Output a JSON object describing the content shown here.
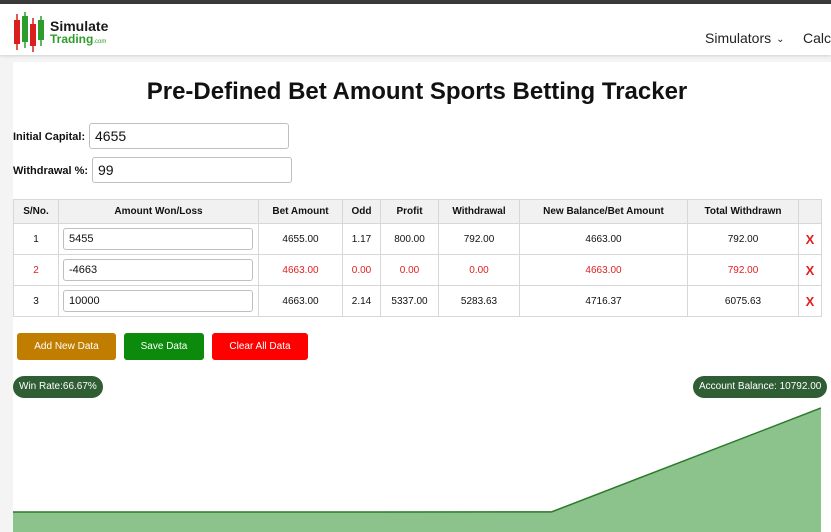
{
  "brand": {
    "name_line1": "Simulate",
    "name_line2": "Trading",
    "domain_suffix": ".com",
    "accent_color": "#2e9d2e"
  },
  "nav": {
    "simulators": "Simulators",
    "calculators": "Calculators"
  },
  "title": "Pre-Defined Bet Amount Sports Betting Tracker",
  "form": {
    "initial_capital_label": "Initial Capital:",
    "initial_capital_value": "4655",
    "withdrawal_label": "Withdrawal %:",
    "withdrawal_value": "99"
  },
  "table": {
    "headers": [
      "S/No.",
      "Amount Won/Loss",
      "Bet Amount",
      "Odd",
      "Profit",
      "Withdrawal",
      "New Balance/Bet Amount",
      "Total Withdrawn",
      ""
    ],
    "rows": [
      {
        "sno": "1",
        "amount": "5455",
        "bet": "4655.00",
        "odd": "1.17",
        "profit": "800.00",
        "withdrawal": "792.00",
        "new_balance": "4663.00",
        "total_withdrawn": "792.00",
        "delete": "X",
        "status": "win"
      },
      {
        "sno": "2",
        "amount": "-4663",
        "bet": "4663.00",
        "odd": "0.00",
        "profit": "0.00",
        "withdrawal": "0.00",
        "new_balance": "4663.00",
        "total_withdrawn": "792.00",
        "delete": "X",
        "status": "loss"
      },
      {
        "sno": "3",
        "amount": "10000",
        "bet": "4663.00",
        "odd": "2.14",
        "profit": "5337.00",
        "withdrawal": "5283.63",
        "new_balance": "4716.37",
        "total_withdrawn": "6075.63",
        "delete": "X",
        "status": "win"
      }
    ],
    "loss_color": "#e02020"
  },
  "buttons": {
    "add": {
      "label": "Add New Data",
      "color": "#c07d00"
    },
    "save": {
      "label": "Save Data",
      "color": "#0b8a0b"
    },
    "clear": {
      "label": "Clear All Data",
      "color": "#ff0000"
    }
  },
  "stats": {
    "win_rate": "Win Rate:66.67%",
    "account_balance": "Account Balance: 10792.00"
  },
  "chart_data": {
    "type": "area",
    "x": [
      0,
      1,
      2,
      3
    ],
    "values": [
      4655,
      4655,
      4663,
      10792
    ],
    "fill_color": "#8cc28c",
    "line_color": "#2a7a2a"
  }
}
